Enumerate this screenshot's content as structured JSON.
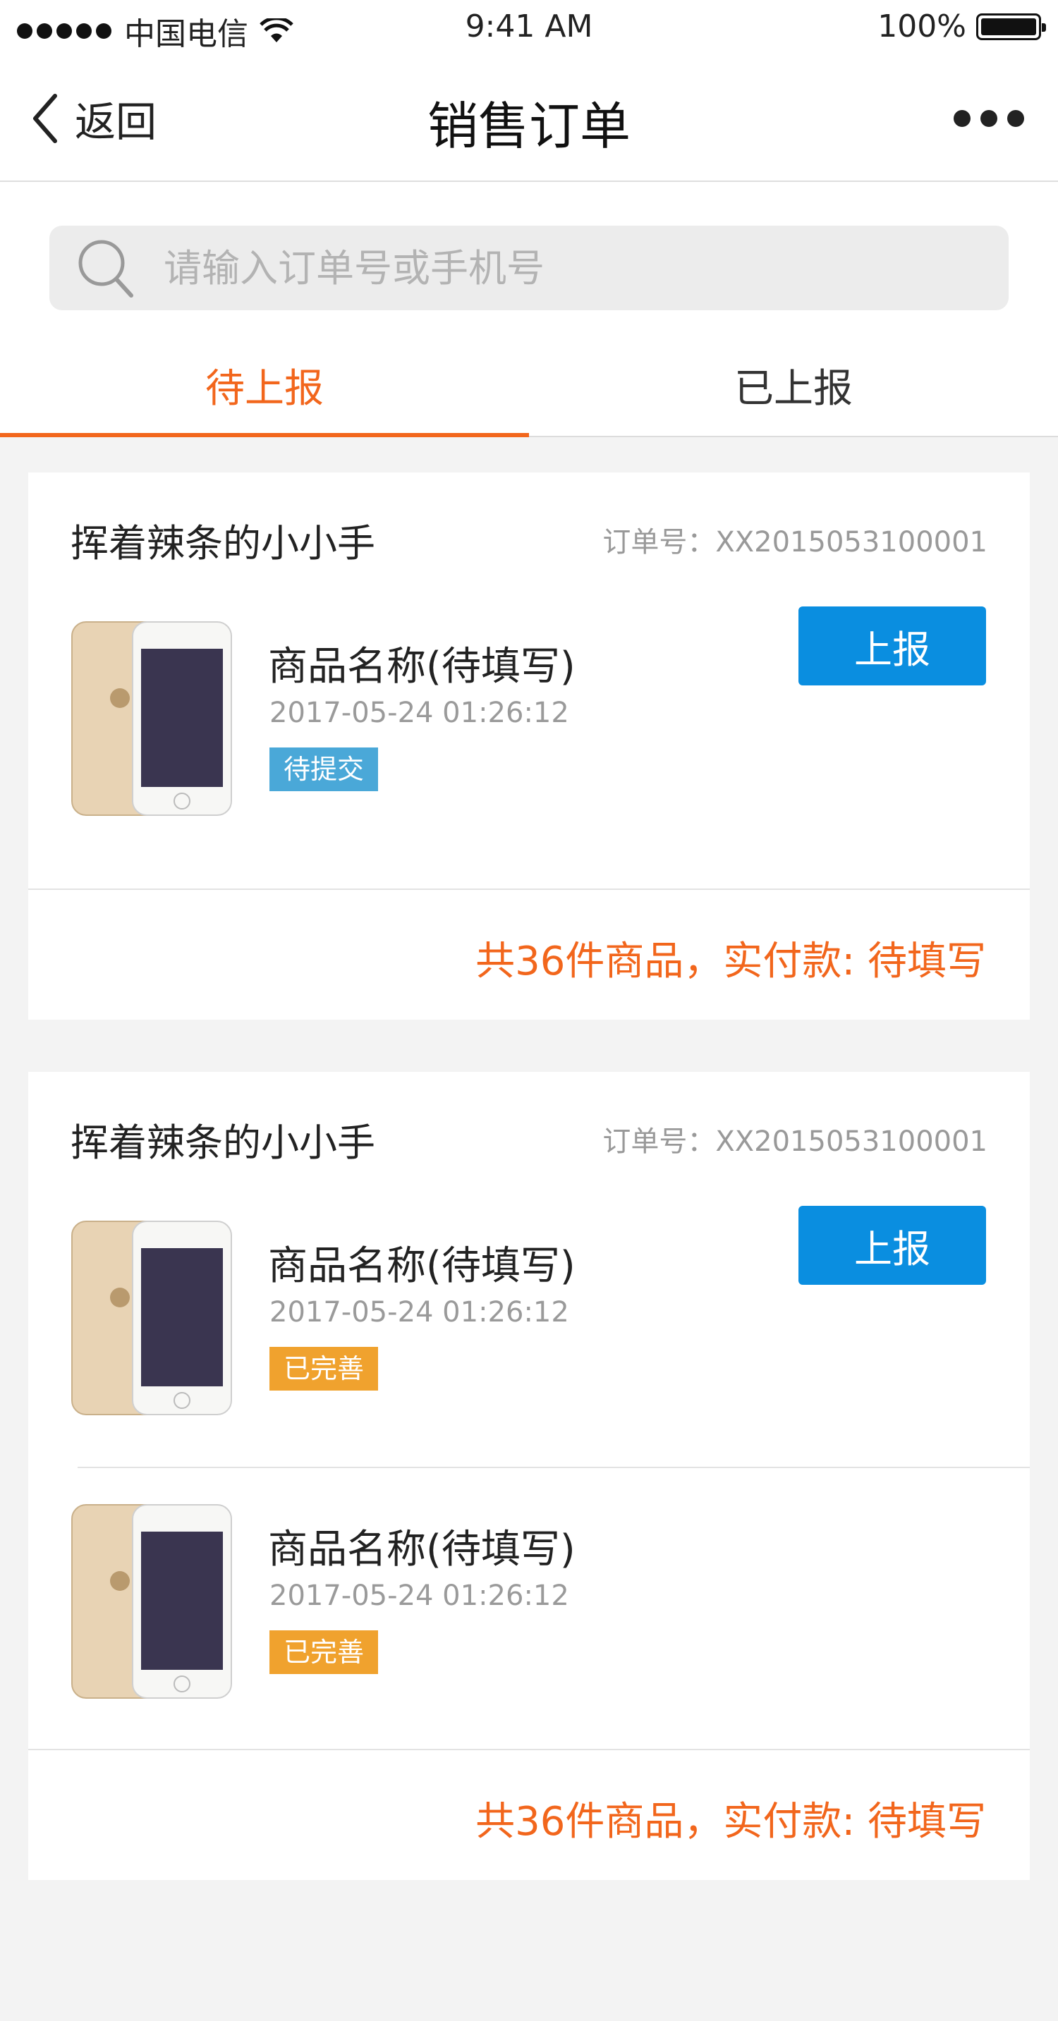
{
  "status": {
    "carrier": "中国电信",
    "time": "9:41 AM",
    "battery": "100%"
  },
  "nav": {
    "back_label": "返回",
    "title": "销售订单"
  },
  "search": {
    "placeholder": "请输入订单号或手机号"
  },
  "tabs": [
    {
      "label": "待上报",
      "active": true
    },
    {
      "label": "已上报",
      "active": false
    }
  ],
  "orders": [
    {
      "shop": "挥着辣条的小小手",
      "order_no": "订单号：XX2015053100001",
      "items": [
        {
          "name": "商品名称(待填写)",
          "date": "2017-05-24 01:26:12",
          "status": "待提交",
          "status_color": "#4aa8d8",
          "action": "上报"
        }
      ],
      "total": "共36件商品，实付款: 待填写"
    },
    {
      "shop": "挥着辣条的小小手",
      "order_no": "订单号：XX2015053100001",
      "items": [
        {
          "name": "商品名称(待填写)",
          "date": "2017-05-24 01:26:12",
          "status": "已完善",
          "status_color": "#f0a22e",
          "action": "上报"
        },
        {
          "name": "商品名称(待填写)",
          "date": "2017-05-24 01:26:12",
          "status": "已完善",
          "status_color": "#f0a22e"
        }
      ],
      "total": "共36件商品，实付款: 待填写"
    }
  ],
  "colors": {
    "accent": "#f2661c",
    "button": "#0a8ee0"
  }
}
